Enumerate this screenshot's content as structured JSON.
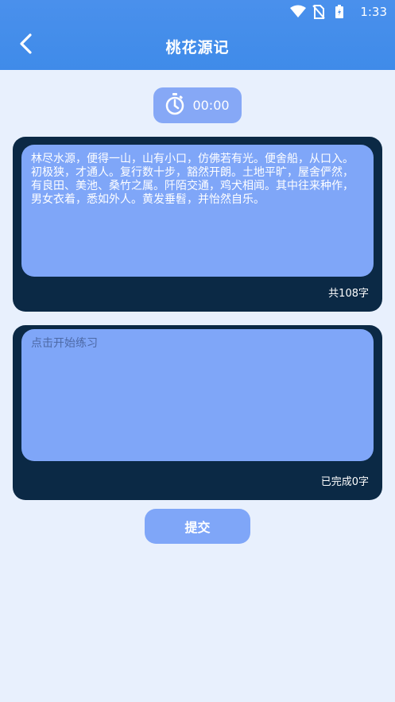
{
  "status": {
    "time": "1:33"
  },
  "header": {
    "title": "桃花源记"
  },
  "timer": {
    "value": "00:00"
  },
  "source": {
    "text": "林尽水源，便得一山，山有小口，仿佛若有光。便舍船，从口入。初极狭，才通人。复行数十步，豁然开朗。土地平旷，屋舍俨然，有良田、美池、桑竹之属。阡陌交通，鸡犬相闻。其中往来种作，男女衣着，悉如外人。黄发垂髫，并怡然自乐。",
    "count": "共108字"
  },
  "practice": {
    "placeholder": "点击开始练习",
    "value": "",
    "count": "已完成0字"
  },
  "submit": {
    "label": "提交"
  },
  "colors": {
    "header": "#4a90ec",
    "background": "#e8f0fd",
    "panel": "#0b2945",
    "panel_inner": "#7fa6f8",
    "timer_bg": "#86a8f6"
  }
}
